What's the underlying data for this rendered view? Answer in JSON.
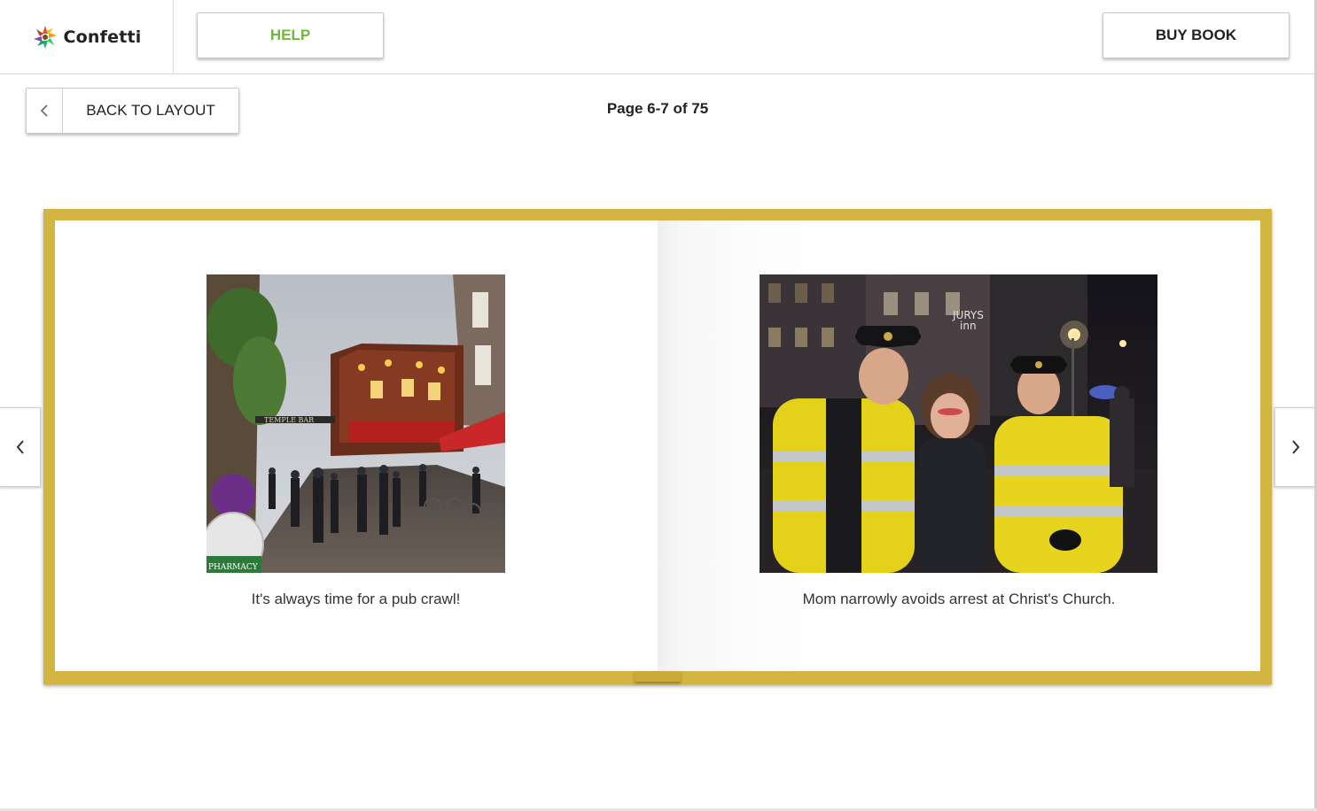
{
  "app": {
    "logo_text": "Confetti"
  },
  "header": {
    "help_label": "HELP",
    "buy_label": "BUY BOOK"
  },
  "subheader": {
    "back_label": "BACK TO LAYOUT",
    "page_indicator": "Page 6-7 of 75"
  },
  "book": {
    "left_page": {
      "caption": "It's always time for a pub crawl!",
      "photo_text": [
        "TEMPLE BAR",
        "PHARMACY"
      ]
    },
    "right_page": {
      "caption": "Mom narrowly avoids arrest at Christ's Church.",
      "photo_text": [
        "JURYS",
        "inn"
      ]
    }
  },
  "colors": {
    "book_border": "#d2b543",
    "help_text": "#6fb83f",
    "text": "#222222"
  },
  "icons": {
    "logo": "confetti-flower-logo-icon",
    "back": "chevron-left-icon",
    "prev_page": "chevron-left-icon",
    "next_page": "chevron-right-icon"
  }
}
